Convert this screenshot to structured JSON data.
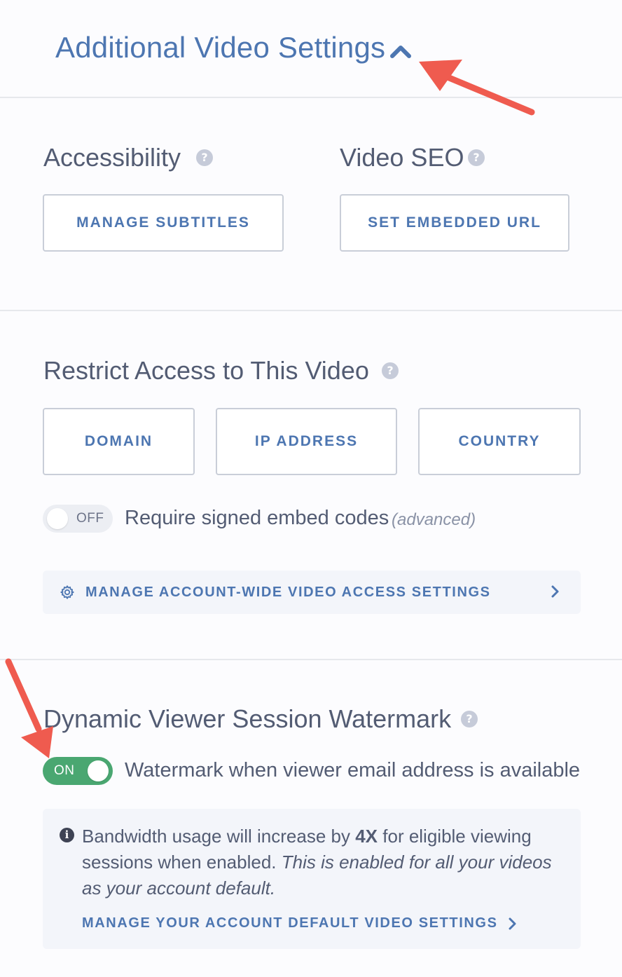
{
  "header": {
    "title": "Additional Video Settings"
  },
  "accessibility": {
    "title": "Accessibility",
    "button": "MANAGE SUBTITLES"
  },
  "seo": {
    "title": "Video SEO",
    "button": "SET EMBEDDED URL"
  },
  "restrict": {
    "title": "Restrict Access to This Video",
    "buttons": [
      "DOMAIN",
      "IP ADDRESS",
      "COUNTRY"
    ],
    "signed_toggle_state": "OFF",
    "signed_label": "Require signed embed codes",
    "signed_note": "(advanced)",
    "account_link": "MANAGE ACCOUNT-WIDE VIDEO ACCESS SETTINGS"
  },
  "watermark": {
    "title": "Dynamic Viewer Session Watermark",
    "toggle_state": "ON",
    "toggle_label": "Watermark when viewer email address is available",
    "info_pre": "Bandwidth usage will increase by ",
    "info_bold": "4X",
    "info_post": " for eligible viewing sessions when enabled. ",
    "info_italic": "This is enabled for all your videos as your account default.",
    "account_link": "MANAGE YOUR ACCOUNT DEFAULT VIDEO SETTINGS"
  },
  "icons": {
    "help": "help-question-icon",
    "collapse": "chevron-up-icon",
    "gear": "gear-icon",
    "chevron_right": "chevron-right-icon",
    "info": "info-icon",
    "annotation": "red-arrow-annotation"
  },
  "colors": {
    "accent": "#4d76b1",
    "toggle_on": "#4aa771",
    "annotation_arrow": "#ef5b4f"
  }
}
